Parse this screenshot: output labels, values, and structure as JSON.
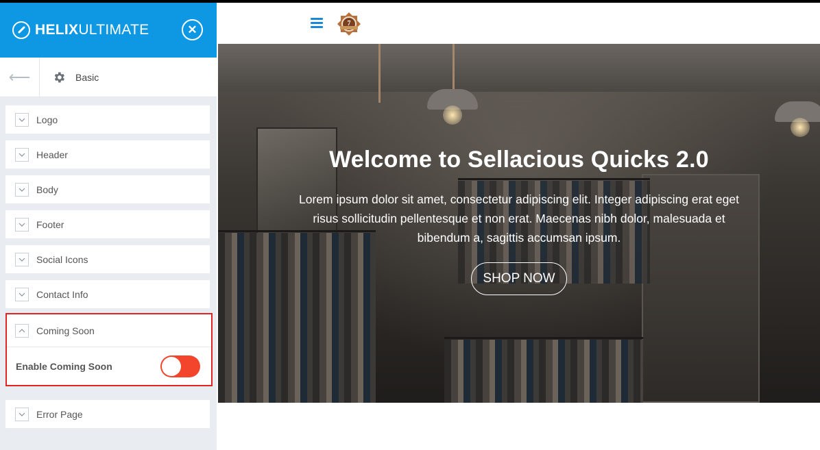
{
  "sidebar": {
    "brand": {
      "bold": "HELIX",
      "light": "ULTIMATE"
    },
    "section_title": "Basic",
    "panels": [
      {
        "label": "Logo"
      },
      {
        "label": "Header"
      },
      {
        "label": "Body"
      },
      {
        "label": "Footer"
      },
      {
        "label": "Social Icons"
      },
      {
        "label": "Contact Info"
      }
    ],
    "coming_soon": {
      "label": "Coming Soon",
      "option_label": "Enable Coming Soon",
      "enabled": false
    },
    "error_page": {
      "label": "Error Page"
    }
  },
  "main": {
    "logo_number": "7",
    "hero": {
      "title": "Welcome to Sellacious Quicks 2.0",
      "text": "Lorem ipsum dolor sit amet, consectetur adipiscing elit. Integer adipiscing erat eget risus sollicitudin pellentesque et non erat. Maecenas nibh dolor, malesuada et bibendum a, sagittis accumsan ipsum.",
      "button": "SHOP NOW"
    }
  },
  "colors": {
    "brand_blue": "#0e98e3",
    "toggle_red": "#f2452b",
    "highlight_border": "#e02424",
    "menu_blue": "#1a88d9"
  },
  "icons": {
    "brand": "helix-logo-icon",
    "close": "close-icon",
    "back": "arrow-left-icon",
    "settings": "gear-icon",
    "chevron_down": "chevron-down-icon",
    "chevron_up": "chevron-up-icon",
    "menu": "hamburger-icon"
  }
}
